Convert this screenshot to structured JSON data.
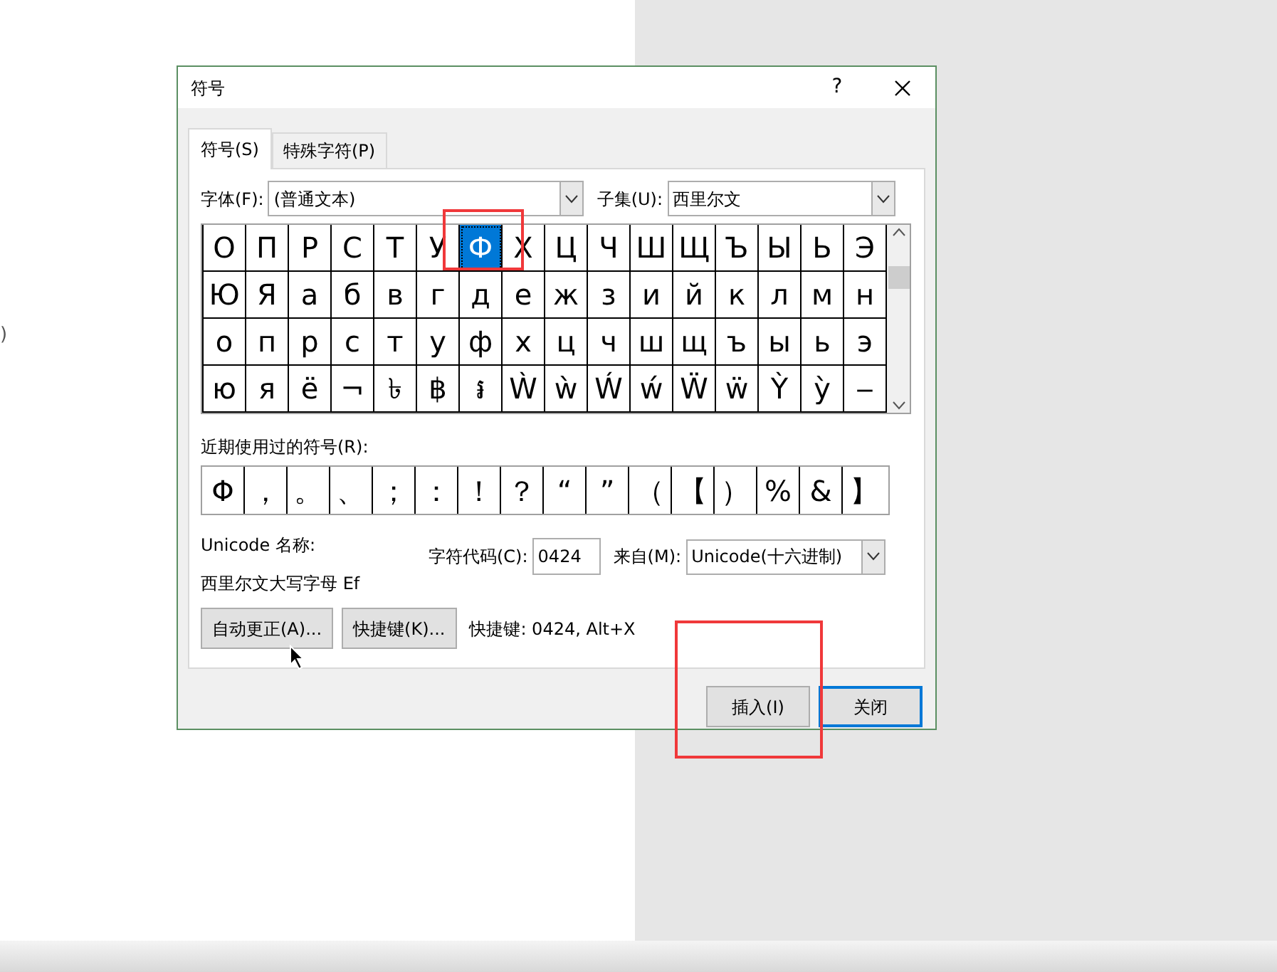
{
  "background": {
    "edge_text": ")"
  },
  "window": {
    "title": "符号",
    "help": "?"
  },
  "tabs": [
    {
      "label": "符号(S)",
      "selected": true
    },
    {
      "label": "特殊字符(P)",
      "selected": false
    }
  ],
  "font": {
    "label": "字体(F):",
    "value": "(普通文本)"
  },
  "subset": {
    "label": "子集(U):",
    "value": "西里尔文"
  },
  "symbol_grid": {
    "rows": [
      [
        {
          "char": "О",
          "selected": false
        },
        {
          "char": "П",
          "selected": false
        },
        {
          "char": "Р",
          "selected": false
        },
        {
          "char": "С",
          "selected": false
        },
        {
          "char": "Т",
          "selected": false
        },
        {
          "char": "У",
          "selected": false
        },
        {
          "char": "Ф",
          "selected": true
        },
        {
          "char": "Х",
          "selected": false
        },
        {
          "char": "Ц",
          "selected": false
        },
        {
          "char": "Ч",
          "selected": false
        },
        {
          "char": "Ш",
          "selected": false
        },
        {
          "char": "Щ",
          "selected": false
        },
        {
          "char": "Ъ",
          "selected": false
        },
        {
          "char": "Ы",
          "selected": false
        },
        {
          "char": "Ь",
          "selected": false
        },
        {
          "char": "Э",
          "selected": false
        }
      ],
      [
        {
          "char": "Ю",
          "selected": false
        },
        {
          "char": "Я",
          "selected": false
        },
        {
          "char": "а",
          "selected": false
        },
        {
          "char": "б",
          "selected": false
        },
        {
          "char": "в",
          "selected": false
        },
        {
          "char": "г",
          "selected": false
        },
        {
          "char": "д",
          "selected": false
        },
        {
          "char": "е",
          "selected": false
        },
        {
          "char": "ж",
          "selected": false
        },
        {
          "char": "з",
          "selected": false
        },
        {
          "char": "и",
          "selected": false
        },
        {
          "char": "й",
          "selected": false
        },
        {
          "char": "к",
          "selected": false
        },
        {
          "char": "л",
          "selected": false
        },
        {
          "char": "м",
          "selected": false
        },
        {
          "char": "н",
          "selected": false
        }
      ],
      [
        {
          "char": "о",
          "selected": false
        },
        {
          "char": "п",
          "selected": false
        },
        {
          "char": "р",
          "selected": false
        },
        {
          "char": "с",
          "selected": false
        },
        {
          "char": "т",
          "selected": false
        },
        {
          "char": "у",
          "selected": false
        },
        {
          "char": "ф",
          "selected": false
        },
        {
          "char": "х",
          "selected": false
        },
        {
          "char": "ц",
          "selected": false
        },
        {
          "char": "ч",
          "selected": false
        },
        {
          "char": "ш",
          "selected": false
        },
        {
          "char": "щ",
          "selected": false
        },
        {
          "char": "ъ",
          "selected": false
        },
        {
          "char": "ы",
          "selected": false
        },
        {
          "char": "ь",
          "selected": false
        },
        {
          "char": "э",
          "selected": false
        }
      ],
      [
        {
          "char": "ю",
          "selected": false
        },
        {
          "char": "я",
          "selected": false
        },
        {
          "char": "ё",
          "selected": false
        },
        {
          "char": "¬",
          "selected": false
        },
        {
          "char": "৳",
          "selected": false
        },
        {
          "char": "฿",
          "selected": false
        },
        {
          "char": "៛",
          "selected": false
        },
        {
          "char": "Ẁ",
          "selected": false
        },
        {
          "char": "ẁ",
          "selected": false
        },
        {
          "char": "Ẃ",
          "selected": false
        },
        {
          "char": "ẃ",
          "selected": false
        },
        {
          "char": "Ẅ",
          "selected": false
        },
        {
          "char": "ẅ",
          "selected": false
        },
        {
          "char": "Ỳ",
          "selected": false
        },
        {
          "char": "ỳ",
          "selected": false
        },
        {
          "char": "‒",
          "selected": false
        }
      ]
    ]
  },
  "recent": {
    "label": "近期使用过的符号(R):",
    "symbols": [
      "Φ",
      "，",
      "。",
      "、",
      "；",
      "：",
      "！",
      "？",
      "“",
      "”",
      "（",
      "【",
      "）",
      "%",
      "&",
      "】"
    ]
  },
  "unicode_name": {
    "label": "Unicode 名称:",
    "value": "西里尔文大写字母 Ef"
  },
  "char_code": {
    "label": "字符代码(C):",
    "value": "0424"
  },
  "from": {
    "label": "来自(M):",
    "value": "Unicode(十六进制)"
  },
  "buttons_left": [
    "自动更正(A)...",
    "快捷键(K)..."
  ],
  "shortcut_text": "快捷键: 0424, Alt+X",
  "footer_buttons": [
    {
      "label": "插入(I)",
      "default": false
    },
    {
      "label": "关闭",
      "default": true
    }
  ]
}
